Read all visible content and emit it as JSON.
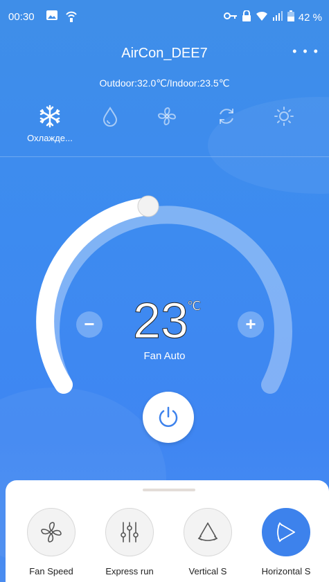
{
  "status_bar": {
    "time": "00:30",
    "battery": "42 %"
  },
  "header": {
    "title": "AirCon_DEE7",
    "more_icon": "more-dots-icon",
    "temperatures": "Outdoor:32.0℃/Indoor:23.5℃"
  },
  "modes": [
    {
      "icon": "snowflake-icon",
      "label": "Охлажде...",
      "active": true
    },
    {
      "icon": "water-drop-icon",
      "label": "",
      "active": false
    },
    {
      "icon": "fan-icon",
      "label": "",
      "active": false
    },
    {
      "icon": "auto-cycle-icon",
      "label": "",
      "active": false
    },
    {
      "icon": "sun-icon",
      "label": "",
      "active": false
    }
  ],
  "thermostat": {
    "temperature": "23",
    "unit": "℃",
    "fan_status": "Fan Auto",
    "minus_label": "−",
    "plus_label": "+",
    "level_fraction": 0.5
  },
  "functions": [
    {
      "label": "Fan Speed",
      "icon": "fan-speed-icon",
      "active": false
    },
    {
      "label": "Express run",
      "icon": "sliders-icon",
      "active": false
    },
    {
      "label": "Vertical S",
      "icon": "vertical-swing-icon",
      "active": false
    },
    {
      "label": "Horizontal S",
      "icon": "horizontal-swing-icon",
      "active": true
    }
  ],
  "colors": {
    "background": "#3f8ee8",
    "accent": "#3d82ec",
    "white": "#ffffff"
  }
}
